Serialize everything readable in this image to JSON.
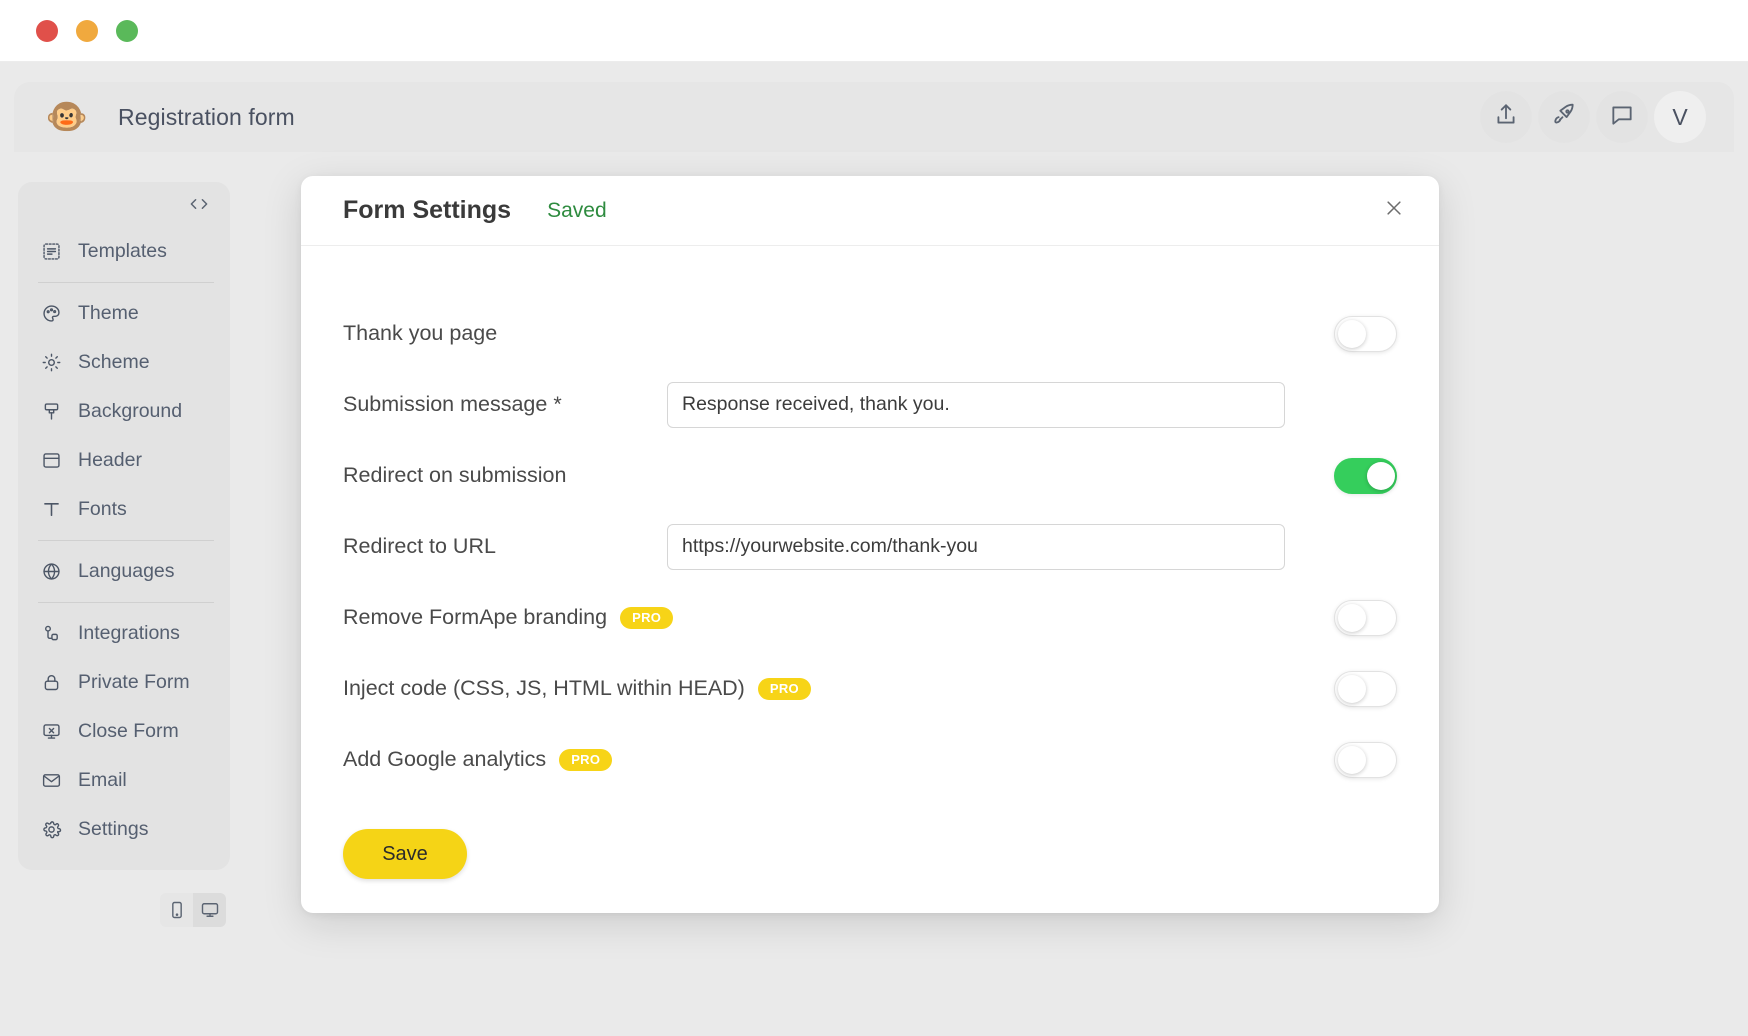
{
  "window": {
    "traffic_lights": [
      {
        "name": "close",
        "color": "#e0504a"
      },
      {
        "name": "minimize",
        "color": "#f0a93e"
      },
      {
        "name": "maximize",
        "color": "#5ab95a"
      }
    ]
  },
  "topbar": {
    "logo_emoji": "🐵",
    "title": "Registration form",
    "actions": [
      {
        "name": "share",
        "icon": "upload-icon"
      },
      {
        "name": "publish",
        "icon": "rocket-icon"
      },
      {
        "name": "comments",
        "icon": "chat-icon"
      }
    ],
    "avatar_initial": "V"
  },
  "sidebar": {
    "code_toggle": "<>",
    "items": [
      {
        "label": "Templates",
        "icon": "templates-icon",
        "sep_after": true
      },
      {
        "label": "Theme",
        "icon": "palette-icon",
        "sep_after": false
      },
      {
        "label": "Scheme",
        "icon": "sun-icon",
        "sep_after": false
      },
      {
        "label": "Background",
        "icon": "brush-icon",
        "sep_after": false
      },
      {
        "label": "Header",
        "icon": "layout-icon",
        "sep_after": false
      },
      {
        "label": "Fonts",
        "icon": "text-icon",
        "sep_after": true
      },
      {
        "label": "Languages",
        "icon": "globe-icon",
        "sep_after": true
      },
      {
        "label": "Integrations",
        "icon": "integrations-icon",
        "sep_after": false
      },
      {
        "label": "Private Form",
        "icon": "lock-icon",
        "sep_after": false
      },
      {
        "label": "Close Form",
        "icon": "close-form-icon",
        "sep_after": false
      },
      {
        "label": "Email",
        "icon": "envelope-icon",
        "sep_after": false
      },
      {
        "label": "Settings",
        "icon": "gear-icon",
        "sep_after": false
      }
    ]
  },
  "device_toggle": {
    "mobile": "mobile-icon",
    "desktop": "desktop-icon",
    "active": "desktop"
  },
  "modal": {
    "title": "Form Settings",
    "status": "Saved",
    "close_label": "×",
    "rows": [
      {
        "label": "Thank you page",
        "type": "toggle",
        "toggle_on": false,
        "pro": false
      },
      {
        "label": "Submission message *",
        "type": "input",
        "value": "Response received, thank you.",
        "placeholder": "Response received, thank you.",
        "pro": false
      },
      {
        "label": "Redirect on submission",
        "type": "toggle",
        "toggle_on": true,
        "pro": false
      },
      {
        "label": "Redirect to URL",
        "type": "input",
        "value": "https://yourwebsite.com/thank-you",
        "placeholder": "https://yourwebsite.com/thank-you",
        "pro": false
      },
      {
        "label": "Remove FormApe branding",
        "type": "toggle",
        "toggle_on": false,
        "pro": true,
        "pro_label": "PRO"
      },
      {
        "label": "Inject code (CSS, JS, HTML within HEAD)",
        "type": "toggle",
        "toggle_on": false,
        "pro": true,
        "pro_label": "PRO"
      },
      {
        "label": "Add Google analytics",
        "type": "toggle",
        "toggle_on": false,
        "pro": true,
        "pro_label": "PRO"
      }
    ],
    "save_label": "Save"
  },
  "colors": {
    "accent_yellow": "#f5d416",
    "toggle_on_green": "#35ce5c",
    "saved_green": "#2e8b3f",
    "app_background": "#eaeaea",
    "sidebar_background": "#e3e3e3"
  }
}
